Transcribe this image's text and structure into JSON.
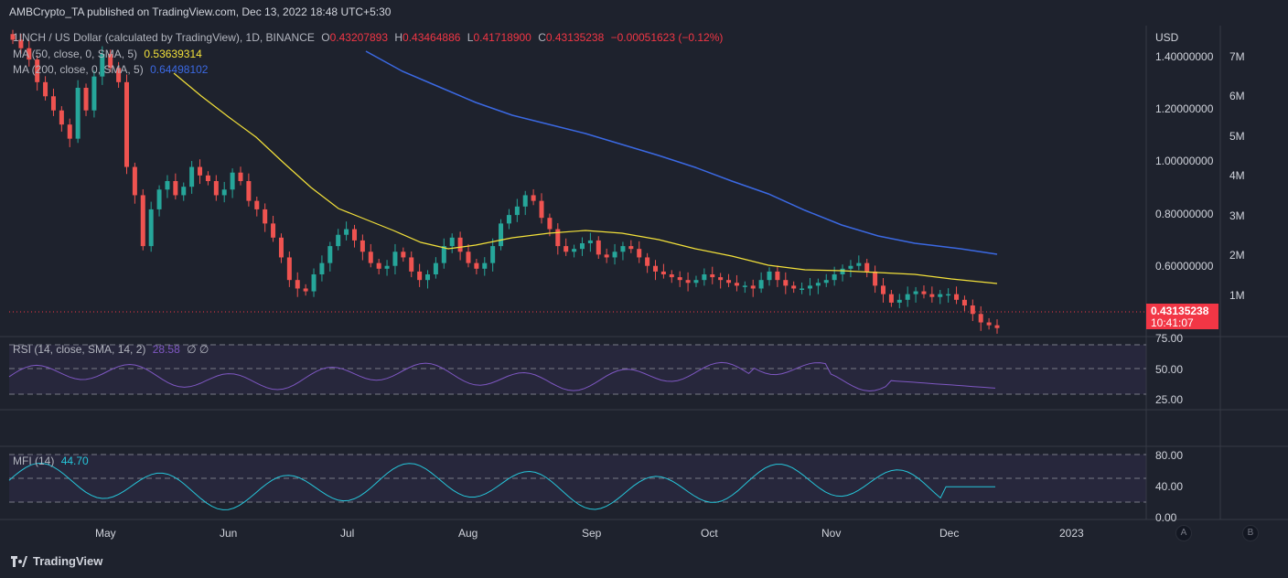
{
  "header": {
    "publisher": "AMBCrypto_TA published on TradingView.com, Dec 13, 2022 18:48 UTC+5:30"
  },
  "symbol": {
    "name": "1INCH / US Dollar (calculated by TradingView), 1D, BINANCE",
    "o_label": "O",
    "o": "0.43207893",
    "h_label": "H",
    "h": "0.43464886",
    "l_label": "L",
    "l": "0.41718900",
    "c_label": "C",
    "c": "0.43135238",
    "change": "−0.00051623 (−0.12%)"
  },
  "ma50": {
    "label": "MA (50, close, 0, SMA, 5)",
    "value": "0.53639314"
  },
  "ma200": {
    "label": "MA (200, close, 0, SMA, 5)",
    "value": "0.64498102"
  },
  "rsi": {
    "label": "RSI (14, close, SMA, 14, 2)",
    "value": "28.58",
    "extra": "∅ ∅"
  },
  "mfi": {
    "label": "MFI (14)",
    "value": "44.70"
  },
  "price_axis": {
    "currency": "USD",
    "ticks": [
      "1.40000000",
      "1.20000000",
      "1.00000000",
      "0.80000000",
      "0.60000000"
    ],
    "last_price": "0.43135238",
    "countdown": "10:41:07"
  },
  "volume_axis": {
    "ticks": [
      "7M",
      "6M",
      "5M",
      "4M",
      "3M",
      "2M",
      "1M"
    ]
  },
  "rsi_axis": {
    "ticks": [
      "75.00",
      "50.00",
      "25.00"
    ]
  },
  "mfi_axis": {
    "ticks": [
      "80.00",
      "40.00",
      "0.00"
    ]
  },
  "time_axis": {
    "ticks": [
      "May",
      "Jun",
      "Jul",
      "Aug",
      "Sep",
      "Oct",
      "Nov",
      "Dec",
      "2023"
    ]
  },
  "footer": {
    "brand": "TradingView"
  },
  "buttons": {
    "a": "A",
    "b": "B"
  },
  "colors": {
    "background": "#1e222d",
    "up": "#26a69a",
    "down": "#ef5350",
    "ma50": "#f3e13a",
    "ma200": "#3b69e3",
    "rsi": "#7e57c2",
    "mfi": "#26c6da"
  },
  "chart_data": [
    {
      "type": "candlestick",
      "title": "1INCH / US Dollar, 1D",
      "x_ticks": [
        "May",
        "Jun",
        "Jul",
        "Aug",
        "Sep",
        "Oct",
        "Nov",
        "Dec",
        "2023"
      ],
      "y_range": [
        0.4,
        1.5
      ],
      "closes_approx": [
        1.45,
        1.42,
        1.38,
        1.3,
        1.25,
        1.2,
        1.15,
        1.1,
        1.28,
        1.2,
        1.32,
        1.4,
        1.35,
        1.3,
        1.0,
        0.9,
        0.72,
        0.85,
        0.92,
        0.95,
        0.9,
        0.93,
        1.0,
        0.97,
        0.95,
        0.9,
        0.92,
        0.98,
        0.95,
        0.88,
        0.85,
        0.8,
        0.75,
        0.68,
        0.6,
        0.57,
        0.56,
        0.62,
        0.66,
        0.72,
        0.76,
        0.78,
        0.74,
        0.7,
        0.66,
        0.64,
        0.65,
        0.7,
        0.68,
        0.63,
        0.6,
        0.62,
        0.66,
        0.72,
        0.75,
        0.7,
        0.66,
        0.64,
        0.66,
        0.72,
        0.8,
        0.83,
        0.86,
        0.9,
        0.88,
        0.82,
        0.78,
        0.72,
        0.7,
        0.71,
        0.73,
        0.74,
        0.69,
        0.68,
        0.7,
        0.72,
        0.71,
        0.68,
        0.65,
        0.63,
        0.62,
        0.61,
        0.6,
        0.59,
        0.6,
        0.62,
        0.61,
        0.6,
        0.59,
        0.58,
        0.58,
        0.57,
        0.6,
        0.63,
        0.6,
        0.58,
        0.57,
        0.57,
        0.58,
        0.59,
        0.6,
        0.62,
        0.64,
        0.65,
        0.66,
        0.63,
        0.58,
        0.55,
        0.52,
        0.53,
        0.55,
        0.56,
        0.55,
        0.54,
        0.55,
        0.55,
        0.53,
        0.51,
        0.48,
        0.45,
        0.44,
        0.43
      ],
      "series": [
        {
          "name": "MA (50, close, 0, SMA, 5)",
          "last": 0.53639314
        },
        {
          "name": "MA (200, close, 0, SMA, 5)",
          "last": 0.64498102
        }
      ]
    },
    {
      "type": "line",
      "title": "RSI (14, close, SMA, 14, 2)",
      "ylim": [
        0,
        100
      ],
      "levels": [
        70,
        50,
        30
      ],
      "last": 28.58
    },
    {
      "type": "line",
      "title": "MFI (14)",
      "ylim": [
        0,
        100
      ],
      "levels": [
        80,
        50,
        20
      ],
      "last": 44.7
    }
  ]
}
